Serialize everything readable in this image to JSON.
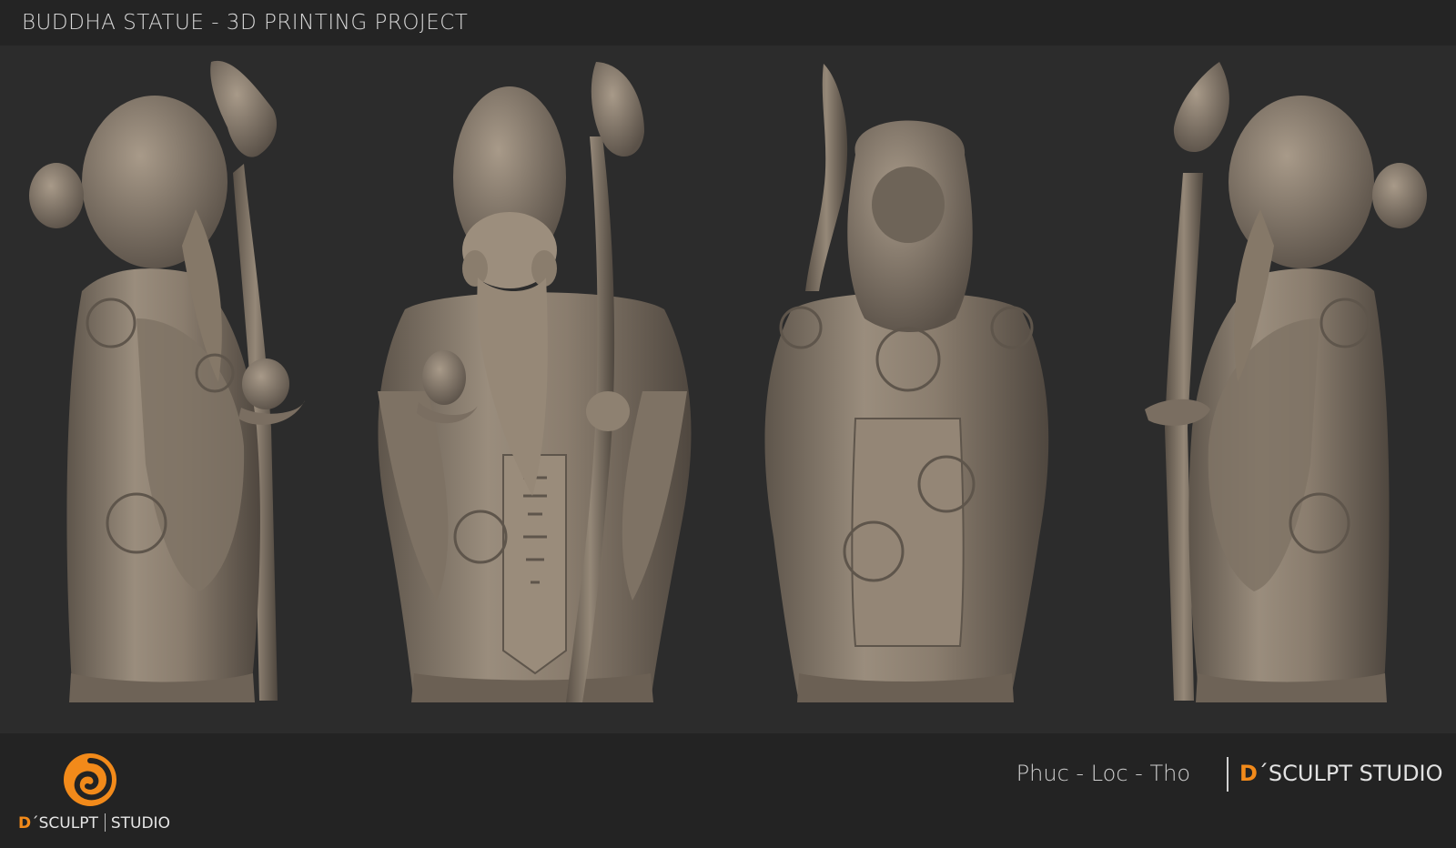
{
  "header": {
    "title": "BUDDHA STATUE - 3D PRINTING PROJECT"
  },
  "views": [
    {
      "name": "side-left-view"
    },
    {
      "name": "front-view"
    },
    {
      "name": "back-view"
    },
    {
      "name": "side-right-view"
    }
  ],
  "footer": {
    "logo": {
      "d_letter": "D",
      "apostrophe_word": "´SCULPT",
      "studio_word": "STUDIO",
      "icon": "swirl-logo-icon"
    },
    "tagline": "Phuc - Loc - Tho",
    "brand": {
      "d_letter": "D",
      "rest": "´SCULPT STUDIO"
    }
  },
  "colors": {
    "background": "#2c2c2c",
    "header_bar": "#242424",
    "footer_bar": "#232323",
    "statue_clay": "#8a7d6e",
    "accent_orange": "#f28a1a"
  }
}
